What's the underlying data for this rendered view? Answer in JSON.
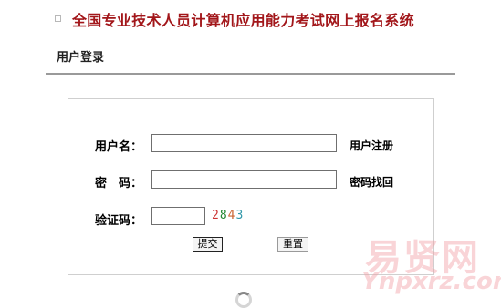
{
  "header": {
    "title": "全国专业技术人员计算机应用能力考试网上报名系统",
    "section_label": "用户登录"
  },
  "login": {
    "username_label": "用户名：",
    "username_value": "",
    "register_link": "用户注册",
    "password_label": "密　码：",
    "password_value": "",
    "recover_link": "密码找回",
    "captcha_label": "验证码：",
    "captcha_value": "",
    "captcha_digits": [
      {
        "char": "2",
        "color": "#cc3333"
      },
      {
        "char": "8",
        "color": "#228833"
      },
      {
        "char": "4",
        "color": "#cc6633"
      },
      {
        "char": "3",
        "color": "#3399aa"
      }
    ],
    "submit_label": "提交",
    "reset_label": "重置"
  },
  "watermark": {
    "cn": "易贤网",
    "en": "Ynpxrz.com"
  }
}
